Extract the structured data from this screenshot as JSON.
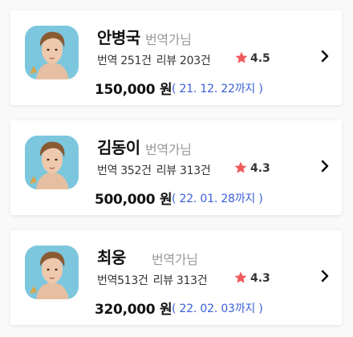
{
  "translators": [
    {
      "name": "안병국",
      "role": "번역가님",
      "translations": "번역 251건",
      "reviews": "리뷰 203건",
      "rating": "4.5",
      "price": "150,000 원",
      "deadline": "( 21. 12. 22까지 )"
    },
    {
      "name": "김동이",
      "role": "번역가님",
      "translations": "번역 352건",
      "reviews": "리뷰 313건",
      "rating": "4.3",
      "price": "500,000 원",
      "deadline": "( 22. 01. 28까지 )"
    },
    {
      "name": "최웅",
      "role": "번역가님",
      "translations": "번역513건",
      "reviews": "리뷰 313건",
      "rating": "4.3",
      "price": "320,000 원",
      "deadline": "( 22. 02. 03까지 )"
    }
  ],
  "colors": {
    "star": "#f05a5a",
    "deadline": "#3a5ed8",
    "avatar_bg": "#7cc7dd"
  },
  "icons": {
    "star": "star-icon",
    "chevron": "chevron-right-icon"
  }
}
